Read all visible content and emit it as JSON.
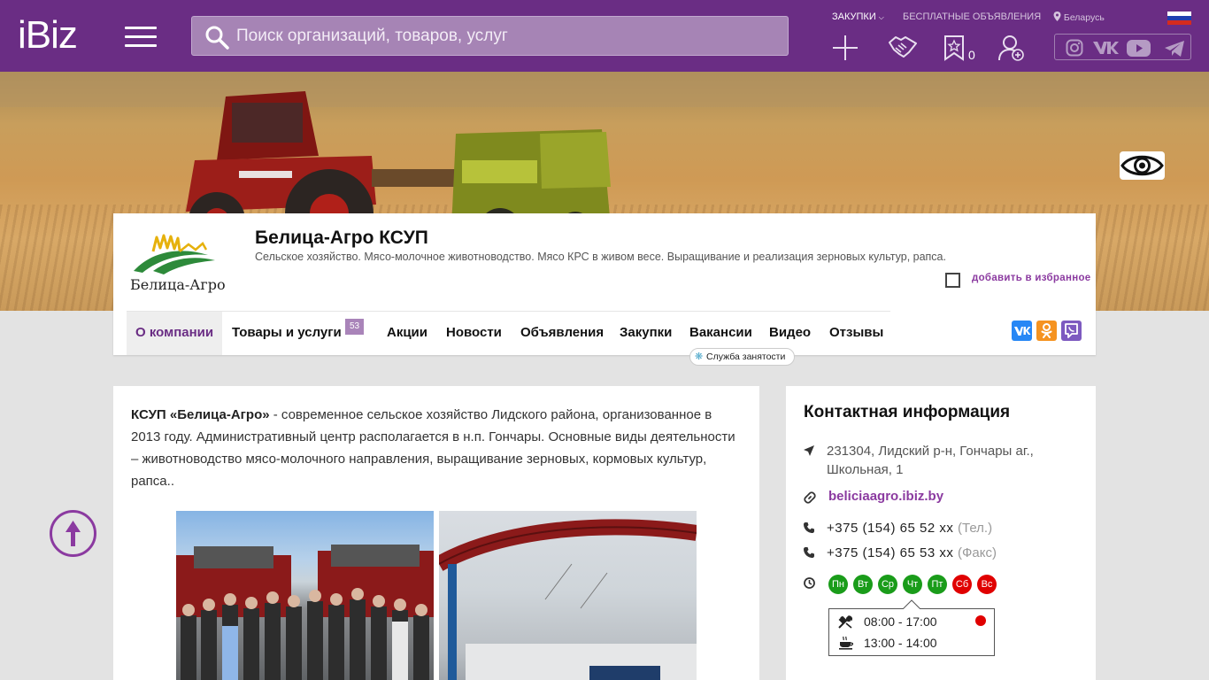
{
  "header": {
    "logo": "iBiz",
    "search_placeholder": "Поиск организаций, товаров, услуг",
    "nav_purchases": "ЗАКУПКИ",
    "nav_ads": "БЕСПЛАТНЫЕ ОБЪЯВЛЕНИЯ",
    "nav_country": "Беларусь",
    "favorites_count": "0",
    "colors": {
      "bar": "#6a2d84",
      "accent": "#8b3aa0"
    }
  },
  "company": {
    "logo_text": "Белица-Агро",
    "name": "Белица-Агро КСУП",
    "description": "Сельское хозяйство. Мясо-молочное животноводство. Мясо КРС в живом весе. Выращивание и реализация зерновых культур, рапса.",
    "add_favorite": "добавить в избранное"
  },
  "tabs": [
    {
      "label": "О компании"
    },
    {
      "label": "Товары и услуги",
      "badge": "53"
    },
    {
      "label": "Акции"
    },
    {
      "label": "Новости"
    },
    {
      "label": "Объявления"
    },
    {
      "label": "Закупки"
    },
    {
      "label": "Вакансии"
    },
    {
      "label": "Видео"
    },
    {
      "label": "Отзывы"
    }
  ],
  "tooltip": "Служба занятости",
  "about": {
    "name_bold": "КСУП «Белица-Агро»",
    "text": " - современное сельское хозяйство Лидского района, организованное в 2013 году. Административный центр располагается в н.п. Гончары. Основные виды деятельности – животноводство мясо-молочного направления, выращивание зерновых, кормовых культур, рапса.."
  },
  "contact": {
    "title": "Контактная информация",
    "address": "231304, Лидский р-н, Гончары аг., Школьная, 1",
    "website": "beliciaagro.ibiz.by",
    "phone1": "+375 (154) 65 52 xx",
    "phone1_note": "(Тел.)",
    "phone2": "+375 (154) 65 53 xx",
    "phone2_note": "(Факс)",
    "days": [
      {
        "label": "Пн",
        "color": "#1a9c1a"
      },
      {
        "label": "Вт",
        "color": "#1a9c1a"
      },
      {
        "label": "Ср",
        "color": "#1a9c1a"
      },
      {
        "label": "Чт",
        "color": "#1a9c1a"
      },
      {
        "label": "Пт",
        "color": "#1a9c1a"
      },
      {
        "label": "Сб",
        "color": "#e00000"
      },
      {
        "label": "Вс",
        "color": "#e00000"
      }
    ],
    "work_hours": "08:00 - 17:00",
    "break_hours": "13:00 - 14:00"
  }
}
